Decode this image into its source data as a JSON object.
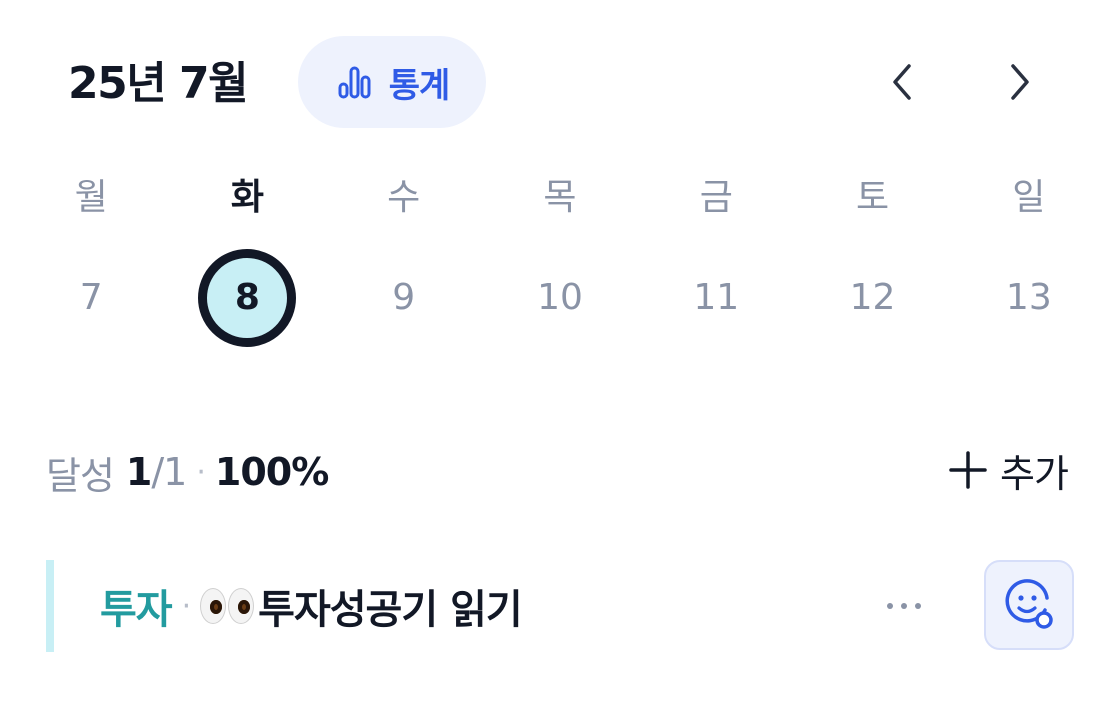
{
  "header": {
    "title": "25년 7월",
    "stats_label": "통계",
    "stats_icon": "bar-chart-icon",
    "prev_icon": "chevron-left-icon",
    "next_icon": "chevron-right-icon"
  },
  "calendar": {
    "weekdays": [
      "월",
      "화",
      "수",
      "목",
      "금",
      "토",
      "일"
    ],
    "dates": [
      "7",
      "8",
      "9",
      "10",
      "11",
      "12",
      "13"
    ],
    "selected_index": 1
  },
  "summary": {
    "label": "달성",
    "done": "1",
    "total": "/1",
    "separator": "·",
    "percent": "100%",
    "add_label": "추가",
    "add_icon": "plus-icon"
  },
  "tasks": [
    {
      "category": "투자",
      "separator": "·",
      "emoji": "eyes-emoji",
      "title": "투자성공기 읽기",
      "more_icon": "more-horizontal-icon",
      "reaction_icon": "add-reaction-icon"
    }
  ],
  "colors": {
    "accent": "#2f5be6",
    "accent_bg": "#eef2fd",
    "selected_fill": "#c8eff5",
    "category": "#229b9f",
    "muted": "#8a93a6",
    "text": "#121826"
  }
}
